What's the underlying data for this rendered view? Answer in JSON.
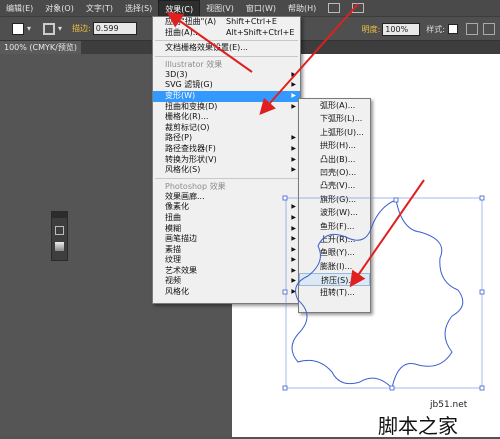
{
  "menubar": {
    "items": [
      {
        "label": "编辑(E)"
      },
      {
        "label": "对象(O)"
      },
      {
        "label": "文字(T)"
      },
      {
        "label": "选择(S)"
      },
      {
        "label": "效果(C)"
      },
      {
        "label": "视图(V)"
      },
      {
        "label": "窗口(W)"
      },
      {
        "label": "帮助(H)"
      }
    ]
  },
  "control_bar": {
    "stroke_label": "描边:",
    "stroke_value": "0.599",
    "opacity_label": "明度:",
    "opacity_value": "100%",
    "style_label": "样式:"
  },
  "document_tab": {
    "title": "100% (CMYK/预览)"
  },
  "effect_menu": {
    "apply_last": {
      "label": "应用\"扭曲\"(A)",
      "shortcut": "Shift+Ctrl+E"
    },
    "last_effect": {
      "label": "扭曲(A)...",
      "shortcut": "Alt+Shift+Ctrl+E"
    },
    "doc_raster": "文档栅格效果设置(E)...",
    "illustrator_header": "Illustrator 效果",
    "illustrator_items": [
      {
        "label": "3D(3)"
      },
      {
        "label": "SVG 滤镜(G)"
      },
      {
        "label": "变形(W)"
      },
      {
        "label": "扭曲和变换(D)"
      },
      {
        "label": "栅格化(R)..."
      },
      {
        "label": "裁剪标记(O)"
      },
      {
        "label": "路径(P)"
      },
      {
        "label": "路径查找器(F)"
      },
      {
        "label": "转换为形状(V)"
      },
      {
        "label": "风格化(S)"
      }
    ],
    "photoshop_header": "Photoshop 效果",
    "photoshop_items": [
      {
        "label": "效果画廊..."
      },
      {
        "label": "像素化"
      },
      {
        "label": "扭曲"
      },
      {
        "label": "模糊"
      },
      {
        "label": "画笔描边"
      },
      {
        "label": "素描"
      },
      {
        "label": "纹理"
      },
      {
        "label": "艺术效果"
      },
      {
        "label": "视频"
      },
      {
        "label": "风格化"
      }
    ]
  },
  "warp_submenu": {
    "items": [
      {
        "label": "弧形(A)..."
      },
      {
        "label": "下弧形(L)..."
      },
      {
        "label": "上弧形(U)..."
      },
      {
        "label": "拱形(H)..."
      },
      {
        "label": "凸出(B)..."
      },
      {
        "label": "凹壳(O)..."
      },
      {
        "label": "凸壳(V)..."
      },
      {
        "label": "旗形(G)..."
      },
      {
        "label": "波形(W)..."
      },
      {
        "label": "鱼形(F)..."
      },
      {
        "label": "上升(R)..."
      },
      {
        "label": "鱼眼(Y)..."
      },
      {
        "label": "膨胀(I)..."
      },
      {
        "label": "挤压(S)..."
      },
      {
        "label": "扭转(T)..."
      }
    ]
  },
  "watermark": {
    "site": "jb51.net",
    "name": "脚本之家"
  },
  "colors": {
    "highlight": "#3399ff",
    "arrow": "#e02020",
    "path": "#3a5fd0"
  }
}
